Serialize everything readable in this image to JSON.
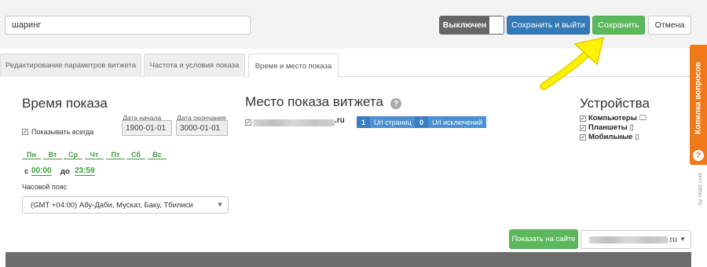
{
  "header": {
    "name_value": "шаринг",
    "toggle_label": "Выключен",
    "save_exit_label": "Сохранить и выйти",
    "save_label": "Сохранить",
    "cancel_label": "Отмена"
  },
  "tabs": [
    {
      "label": "Редактирование параметров витжета",
      "active": false
    },
    {
      "label": "Частота и условия показа",
      "active": false
    },
    {
      "label": "Время и место показа",
      "active": true
    }
  ],
  "time": {
    "title": "Время показа",
    "always_label": "Показывать всегда",
    "always_checked": true,
    "start_label": "Дата начала",
    "start_value": "1900-01-01",
    "end_label": "Дата окончания",
    "end_value": "3000-01-01",
    "days": [
      "Пн",
      "Вт",
      "Ср",
      "Чт",
      "Пт",
      "Сб",
      "Вс"
    ],
    "from_label": "с",
    "from_value": "00:00",
    "to_label": "до",
    "to_value": "23:59",
    "tz_label": "Часовой пояс",
    "tz_value": "(GMT +04:00) Абу-Даби, Мускат, Баку, Тбилиси"
  },
  "place": {
    "title": "Место показа витжета",
    "help_icon": "question-circle-icon",
    "site_suffix": ".ru",
    "site_checked": true,
    "url_pages_count": "1",
    "url_pages_label": "Url страниц",
    "url_excl_count": "0",
    "url_excl_label": "Url исключений"
  },
  "devices": {
    "title": "Устройства",
    "items": [
      {
        "label": "Компьютеры",
        "checked": true,
        "icon": "monitor-icon"
      },
      {
        "label": "Планшеты",
        "checked": true,
        "icon": "tablet-icon"
      },
      {
        "label": "Мобильные",
        "checked": true,
        "icon": "phone-icon"
      }
    ]
  },
  "footer": {
    "show_site_label": "Показать на сайте",
    "site_select_suffix": ".ru"
  },
  "side_widget": {
    "label": "Копилка вопросов",
    "icon": "question-icon"
  },
  "watermark": "by Vitalz.com",
  "colors": {
    "primary": "#337ab7",
    "success": "#5cb85c",
    "accent_orange": "#f07a1a",
    "day_green": "#3c9b3c",
    "arrow_yellow": "#ffee00"
  }
}
